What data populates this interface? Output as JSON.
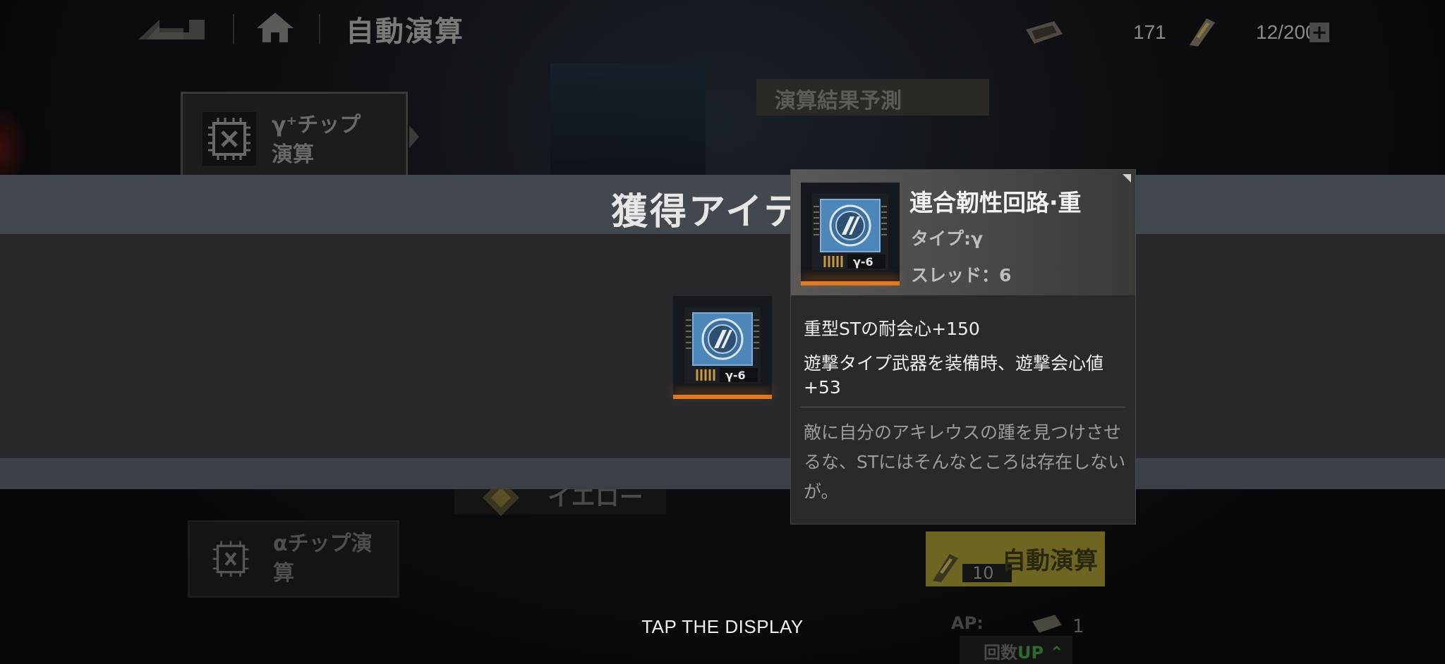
{
  "header": {
    "title": "自動演算",
    "currency_value": "171",
    "stamina_value": "12/200",
    "plus_label": "+"
  },
  "background": {
    "tabs": [
      {
        "label_line1": "γ⁺チップ",
        "label_line2": "演算"
      },
      {
        "label_line1": "αチップ演",
        "label_line2": "算"
      }
    ],
    "predict_label": "演算結果予測",
    "yellow_label": "イエロー",
    "auto_button": {
      "count": "10",
      "label": "自動演算"
    },
    "ap_label": "AP:",
    "ap_value": "1",
    "count_up": {
      "prefix": "回数",
      "accent": "UP"
    }
  },
  "modal": {
    "title": "獲得アイテ",
    "item_chip_label": "γ-6",
    "tap_hint": "TAP THE DISPLAY"
  },
  "tooltip": {
    "name": "連合靭性回路·重",
    "type": "タイプ:γ",
    "thread": "スレッド：6",
    "chip_label": "γ-6",
    "effect1": "重型STの耐会心+150",
    "effect2": "遊撃タイプ武器を装備時、遊撃会心値+53",
    "flavor": "敵に自分のアキレウスの踵を見つけさせるな、STにはそんなところは存在しないが。"
  },
  "colors": {
    "rarity_orange": "#e07a22",
    "chip_blue": "#4d86b8",
    "auto_yellow": "#6e6522",
    "up_green": "#2e6a2e"
  }
}
